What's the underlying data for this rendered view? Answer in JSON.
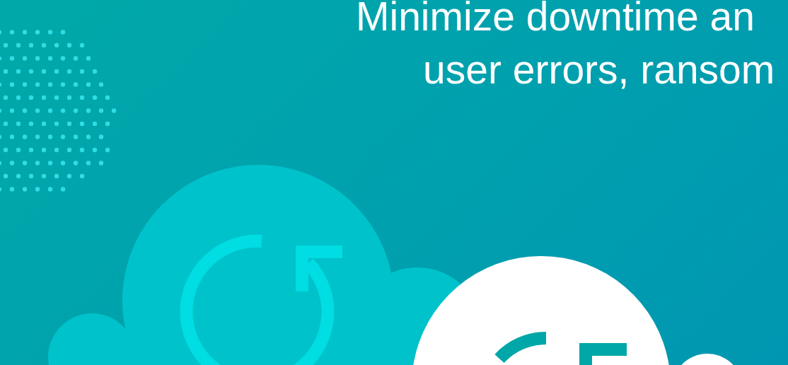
{
  "headline": {
    "lines": [
      "Minimize downtime an",
      "user errors, ransom"
    ]
  }
}
